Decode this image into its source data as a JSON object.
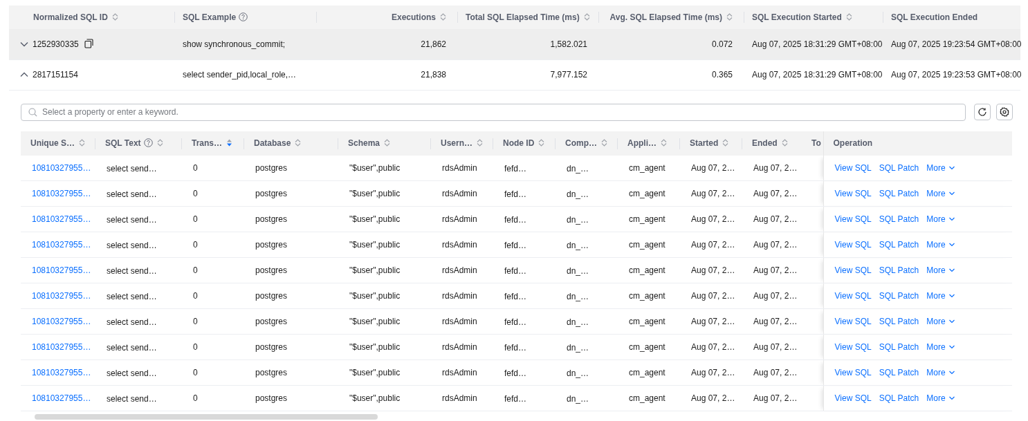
{
  "outer_table": {
    "columns": [
      {
        "label": "Normalized SQL ID",
        "sortable": true,
        "help": false
      },
      {
        "label": "SQL Example",
        "sortable": false,
        "help": true
      },
      {
        "label": "Executions",
        "sortable": true,
        "help": false
      },
      {
        "label": "Total SQL Elapsed Time (ms)",
        "sortable": true,
        "help": false
      },
      {
        "label": "Avg. SQL Elapsed Time (ms)",
        "sortable": true,
        "help": false
      },
      {
        "label": "SQL Execution Started",
        "sortable": true,
        "help": false
      },
      {
        "label": "SQL Execution Ended",
        "sortable": false,
        "help": false
      }
    ],
    "rows": [
      {
        "expanded": false,
        "highlighted": true,
        "copyable": true,
        "cells": [
          "1252930335",
          "show synchronous_commit;",
          "21,862",
          "1,582.021",
          "0.072",
          "Aug 07, 2025 18:31:29 GMT+08:00",
          "Aug 07, 2025 19:23:54 GMT+08:00"
        ]
      },
      {
        "expanded": true,
        "highlighted": false,
        "copyable": false,
        "cells": [
          "2817151154",
          "select sender_pid,local_role,…",
          "21,838",
          "7,977.152",
          "0.365",
          "Aug 07, 2025 18:31:29 GMT+08:00",
          "Aug 07, 2025 19:23:53 GMT+08:00"
        ]
      }
    ]
  },
  "detail": {
    "search": {
      "placeholder": "Select a property or enter a keyword."
    },
    "columns": [
      {
        "label": "Unique S…",
        "sortable": true,
        "sorted": false,
        "help": false
      },
      {
        "label": "SQL Text",
        "sortable": true,
        "sorted": false,
        "help": true
      },
      {
        "label": "Trans…",
        "sortable": true,
        "sorted": true,
        "help": false
      },
      {
        "label": "Database",
        "sortable": true,
        "sorted": false,
        "help": false
      },
      {
        "label": "Schema",
        "sortable": true,
        "sorted": false,
        "help": false
      },
      {
        "label": "Usern…",
        "sortable": true,
        "sorted": false,
        "help": false
      },
      {
        "label": "Node ID",
        "sortable": true,
        "sorted": false,
        "help": false
      },
      {
        "label": "Comp…",
        "sortable": true,
        "sorted": false,
        "help": false
      },
      {
        "label": "Appli…",
        "sortable": true,
        "sorted": false,
        "help": false
      },
      {
        "label": "Started",
        "sortable": true,
        "sorted": false,
        "help": false
      },
      {
        "label": "Ended",
        "sortable": true,
        "sorted": false,
        "help": false
      },
      {
        "label": "To"
      },
      {
        "label": "Operation",
        "sortable": false,
        "help": false
      }
    ],
    "rows": [
      {
        "cells": [
          "10810327955…",
          "select send…",
          "0",
          "postgres",
          "\"$user\",public",
          "rdsAdmin",
          "fefd…",
          "dn_…",
          "cm_agent",
          "Aug 07, 2…",
          "Aug 07, 2…",
          ""
        ],
        "actions": [
          "View SQL",
          "SQL Patch",
          "More"
        ]
      },
      {
        "cells": [
          "10810327955…",
          "select send…",
          "0",
          "postgres",
          "\"$user\",public",
          "rdsAdmin",
          "fefd…",
          "dn_…",
          "cm_agent",
          "Aug 07, 2…",
          "Aug 07, 2…",
          ""
        ],
        "actions": [
          "View SQL",
          "SQL Patch",
          "More"
        ]
      },
      {
        "cells": [
          "10810327955…",
          "select send…",
          "0",
          "postgres",
          "\"$user\",public",
          "rdsAdmin",
          "fefd…",
          "dn_…",
          "cm_agent",
          "Aug 07, 2…",
          "Aug 07, 2…",
          ""
        ],
        "actions": [
          "View SQL",
          "SQL Patch",
          "More"
        ]
      },
      {
        "cells": [
          "10810327955…",
          "select send…",
          "0",
          "postgres",
          "\"$user\",public",
          "rdsAdmin",
          "fefd…",
          "dn_…",
          "cm_agent",
          "Aug 07, 2…",
          "Aug 07, 2…",
          ""
        ],
        "actions": [
          "View SQL",
          "SQL Patch",
          "More"
        ]
      },
      {
        "cells": [
          "10810327955…",
          "select send…",
          "0",
          "postgres",
          "\"$user\",public",
          "rdsAdmin",
          "fefd…",
          "dn_…",
          "cm_agent",
          "Aug 07, 2…",
          "Aug 07, 2…",
          ""
        ],
        "actions": [
          "View SQL",
          "SQL Patch",
          "More"
        ]
      },
      {
        "cells": [
          "10810327955…",
          "select send…",
          "0",
          "postgres",
          "\"$user\",public",
          "rdsAdmin",
          "fefd…",
          "dn_…",
          "cm_agent",
          "Aug 07, 2…",
          "Aug 07, 2…",
          ""
        ],
        "actions": [
          "View SQL",
          "SQL Patch",
          "More"
        ]
      },
      {
        "cells": [
          "10810327955…",
          "select send…",
          "0",
          "postgres",
          "\"$user\",public",
          "rdsAdmin",
          "fefd…",
          "dn_…",
          "cm_agent",
          "Aug 07, 2…",
          "Aug 07, 2…",
          ""
        ],
        "actions": [
          "View SQL",
          "SQL Patch",
          "More"
        ]
      },
      {
        "cells": [
          "10810327955…",
          "select send…",
          "0",
          "postgres",
          "\"$user\",public",
          "rdsAdmin",
          "fefd…",
          "dn_…",
          "cm_agent",
          "Aug 07, 2…",
          "Aug 07, 2…",
          ""
        ],
        "actions": [
          "View SQL",
          "SQL Patch",
          "More"
        ]
      },
      {
        "cells": [
          "10810327955…",
          "select send…",
          "0",
          "postgres",
          "\"$user\",public",
          "rdsAdmin",
          "fefd…",
          "dn_…",
          "cm_agent",
          "Aug 07, 2…",
          "Aug 07, 2…",
          ""
        ],
        "actions": [
          "View SQL",
          "SQL Patch",
          "More"
        ]
      },
      {
        "cells": [
          "10810327955…",
          "select send…",
          "0",
          "postgres",
          "\"$user\",public",
          "rdsAdmin",
          "fefd…",
          "dn_…",
          "cm_agent",
          "Aug 07, 2…",
          "Aug 07, 2…",
          ""
        ],
        "actions": [
          "View SQL",
          "SQL Patch",
          "More"
        ]
      }
    ]
  }
}
